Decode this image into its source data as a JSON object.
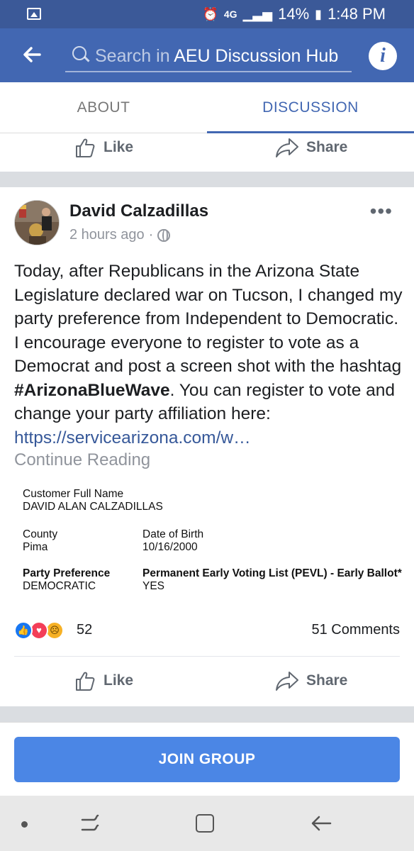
{
  "status_bar": {
    "network": "4G",
    "battery": "14%",
    "time": "1:48 PM"
  },
  "app_bar": {
    "search_placeholder_prefix": "Search in",
    "search_placeholder_group": "AEU Discussion Hub"
  },
  "tabs": [
    {
      "label": "ABOUT"
    },
    {
      "label": "DISCUSSION"
    }
  ],
  "actions": {
    "like": "Like",
    "share": "Share"
  },
  "post": {
    "author": "David Calzadillas",
    "time": "2 hours ago",
    "text_before_hashtag": "Today, after Republicans in the Arizona State Legislature declared war on Tucson, I changed my party preference from Independent to Democratic. I encourage everyone to register to vote as a Democrat and post a screen shot with the hashtag ",
    "hashtag": "#ArizonaBlueWave",
    "text_after_hashtag": ". You can register to vote and change your party affiliation here: ",
    "link": "https://servicearizona.com/w…",
    "continue_reading": "Continue Reading",
    "document": {
      "name_label": "Customer Full Name",
      "name_value": "DAVID ALAN CALZADILLAS",
      "county_label": "County",
      "county_value": "Pima",
      "dob_label": "Date of Birth",
      "dob_value": "10/16/2000",
      "party_label": "Party Preference",
      "party_value": "DEMOCRATIC",
      "pevl_label": "Permanent Early Voting List (PEVL) - Early Ballot*",
      "pevl_value": "YES"
    },
    "reaction_count": "52",
    "comments_count": "51 Comments"
  },
  "join_group": "JOIN GROUP"
}
